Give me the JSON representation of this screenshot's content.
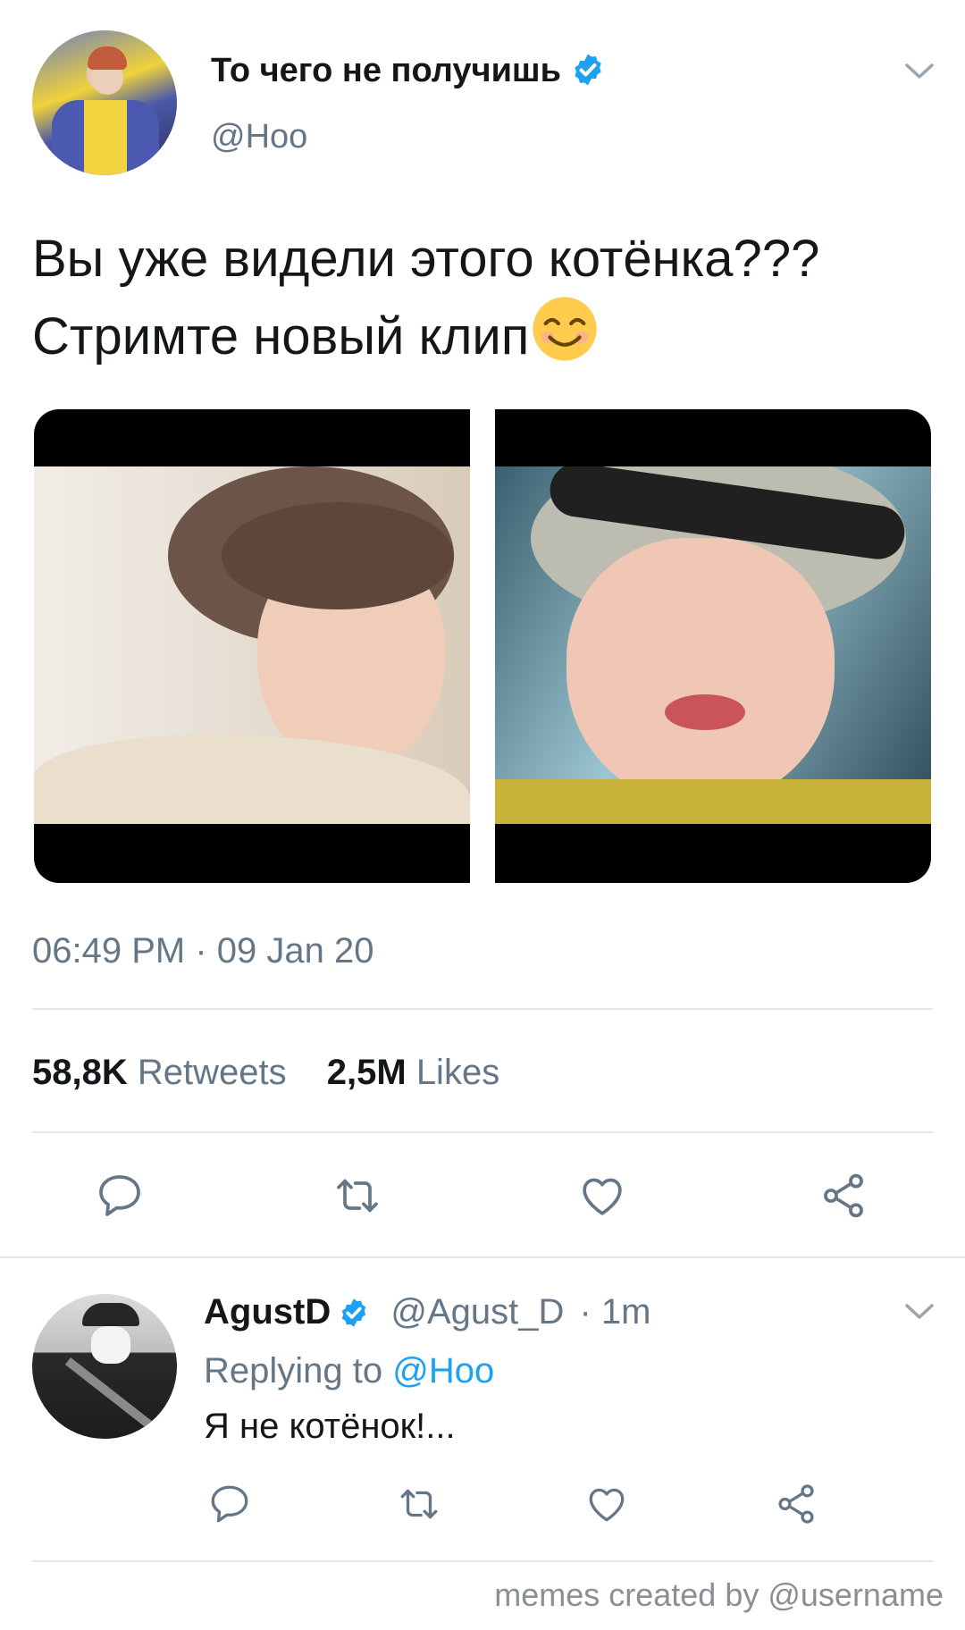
{
  "tweet": {
    "display_name": "То чего не получишь",
    "handle": "@Hoo",
    "text_line1": "Вы уже видели этого котёнка???",
    "text_line2": "Стримте новый клип",
    "timestamp": "06:49 PM · 09 Jan 20",
    "retweets_count": "58,8K",
    "retweets_label": "Retweets",
    "likes_count": "2,5M",
    "likes_label": "Likes"
  },
  "reply": {
    "display_name": "AgustD",
    "handle": "@Agust_D",
    "age": "· 1m",
    "replying_prefix": "Replying to",
    "replying_to": "@Hoo",
    "text": "Я не котёнок!..."
  },
  "icons": {
    "verified": "verified-badge-icon",
    "menu": "chevron-down-icon",
    "reply": "reply-icon",
    "retweet": "retweet-icon",
    "like": "heart-icon",
    "share": "share-icon",
    "emoji": "smiling-face-emoji"
  },
  "colors": {
    "accent": "#1da1f2",
    "secondary_text": "#657786",
    "divider": "#e1e8ed"
  },
  "watermark": "memes created by @username"
}
